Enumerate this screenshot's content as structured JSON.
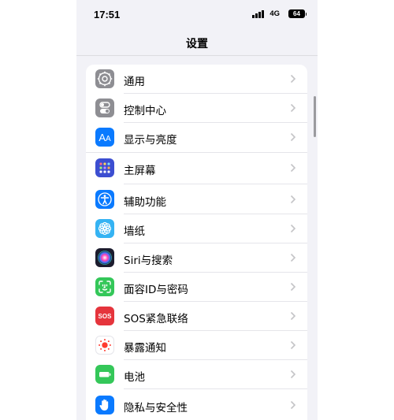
{
  "status_bar": {
    "time": "17:51",
    "network": "4G",
    "battery": "64"
  },
  "nav": {
    "title": "设置"
  },
  "settings": {
    "items": [
      {
        "label": "通用",
        "icon": "gear-icon",
        "color": "#8e8e93"
      },
      {
        "label": "控制中心",
        "icon": "toggles-icon",
        "color": "#8e8e93"
      },
      {
        "label": "显示与亮度",
        "icon": "text-size-icon",
        "color": "#0a7aff"
      },
      {
        "label": "主屏幕",
        "icon": "home-grid-icon",
        "color": "#3c4ed1"
      },
      {
        "label": "辅助功能",
        "icon": "accessibility-icon",
        "color": "#0a7aff"
      },
      {
        "label": "墙纸",
        "icon": "flower-icon",
        "color": "#35b3f3"
      },
      {
        "label": "Siri与搜索",
        "icon": "siri-icon",
        "color": "#1c1c2e"
      },
      {
        "label": "面容ID与密码",
        "icon": "face-id-icon",
        "color": "#34c759"
      },
      {
        "label": "SOS紧急联络",
        "icon": "sos-icon",
        "color": "#e5343c"
      },
      {
        "label": "暴露通知",
        "icon": "exposure-icon",
        "color": "#ffffff"
      },
      {
        "label": "电池",
        "icon": "battery-icon",
        "color": "#34c759"
      },
      {
        "label": "隐私与安全性",
        "icon": "hand-icon",
        "color": "#0a7aff"
      }
    ],
    "sos_text": "SOS"
  }
}
